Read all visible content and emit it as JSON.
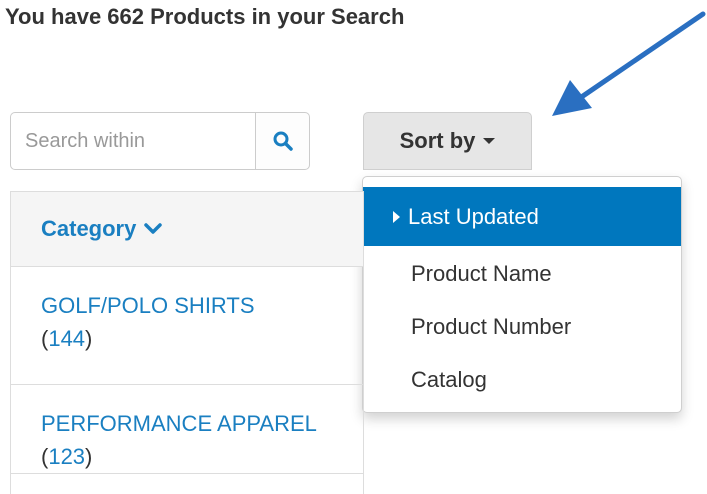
{
  "results": {
    "headline": "You have 662 Products in your Search"
  },
  "search": {
    "placeholder": "Search within",
    "value": ""
  },
  "sort": {
    "label": "Sort by",
    "options": [
      {
        "label": "Last Updated",
        "selected": true
      },
      {
        "label": "Product Name",
        "selected": false
      },
      {
        "label": "Product Number",
        "selected": false
      },
      {
        "label": "Catalog",
        "selected": false
      }
    ]
  },
  "category": {
    "header": "Category",
    "items": [
      {
        "name": "GOLF/POLO SHIRTS",
        "count": "144"
      },
      {
        "name": "PERFORMANCE APPAREL",
        "count": "123"
      }
    ]
  },
  "colors": {
    "accent": "#0077be",
    "link": "#1a7fc1",
    "text": "#333333",
    "arrow": "#2a6fc1"
  },
  "icons": {
    "search": "search-icon",
    "sort_caret": "caret-down-icon",
    "active_caret": "caret-right-icon",
    "category_chevron": "chevron-down-icon",
    "annotation": "arrow-annotation"
  }
}
